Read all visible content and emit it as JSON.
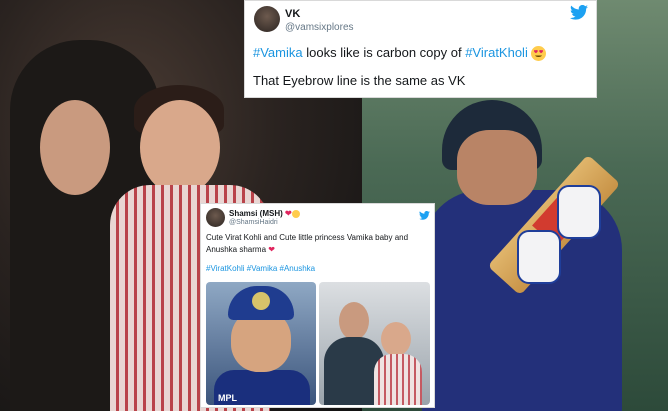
{
  "tweet1": {
    "name": "VK",
    "handle": "@vamsixplores",
    "line1_hash1": "#Vamika",
    "line1_text": " looks like is carbon copy of ",
    "line1_hash2": "#ViratKholi",
    "line2": "That Eyebrow line is the same as VK",
    "emoji_icon": "heart-eyes-emoji"
  },
  "tweet2": {
    "name": "Shamsi (MSH)",
    "handle": "@ShamsiHaidri",
    "line1": "Cute Virat Kohli and Cute little princess Vamika baby and",
    "line2": "Anushka sharma",
    "hashtags": "#ViratKohli #Vamika #Anushka",
    "photo1_text": "MPL",
    "photo1_icon": "child-in-cap-photo",
    "photo2_icon": "mother-and-baby-photo"
  },
  "colors": {
    "twitter_blue": "#1da1f2",
    "hashtag_blue": "#1b95e0",
    "heart_red": "#e0245e"
  }
}
